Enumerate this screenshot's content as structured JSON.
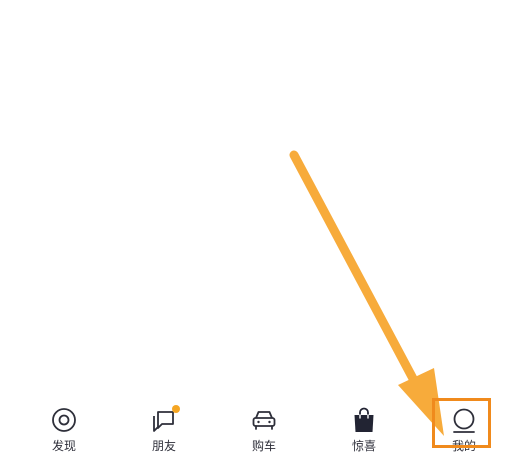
{
  "tabbar": {
    "tabs": [
      {
        "label": "发现",
        "icon": "discover-icon"
      },
      {
        "label": "朋友",
        "icon": "chat-icon",
        "badge_dot": true
      },
      {
        "label": "购车",
        "icon": "car-icon"
      },
      {
        "label": "惊喜",
        "icon": "shopping-bag-icon"
      },
      {
        "label": "我的",
        "icon": "profile-icon",
        "highlighted": true
      }
    ]
  },
  "colors": {
    "icon_stroke": "#2e2f3a",
    "badge": "#f5a623",
    "annotation_arrow": "#f7ab3b",
    "annotation_box": "#f08a1c"
  }
}
